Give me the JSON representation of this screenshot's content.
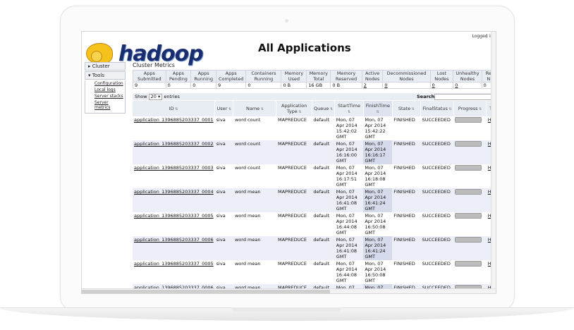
{
  "header": {
    "page_title": "All Applications",
    "logged_in": "Logged in"
  },
  "logo": {
    "text": "hadoop"
  },
  "nav": {
    "cluster_label": "▸ Cluster",
    "tools_label": "▾ Tools",
    "tools_links": [
      "Configuration",
      "Local logs",
      "Server stacks",
      "Server metrics"
    ]
  },
  "metrics": {
    "title": "Cluster Metrics",
    "headers": [
      "Apps Submitted",
      "Apps Pending",
      "Apps Running",
      "Apps Completed",
      "Containers Running",
      "Memory Used",
      "Memory Total",
      "Memory Reserved",
      "Active Nodes",
      "Decommissioned Nodes",
      "Lost Nodes",
      "Unhealthy Nodes",
      "Re N"
    ],
    "values": [
      "9",
      "0",
      "0",
      "9",
      "0",
      "0 B",
      "16 GB",
      "0 B",
      "2",
      "0",
      "0",
      "0",
      "0"
    ]
  },
  "controls": {
    "show_label": "Show",
    "entries_value": "20",
    "entries_label": "entries",
    "search_label": "Search:"
  },
  "table": {
    "headers": [
      "ID",
      "User",
      "Name",
      "Application Type",
      "Queue",
      "StartTime",
      "FinishTime",
      "State",
      "FinalStatus",
      "Progress",
      "T"
    ],
    "rows": [
      {
        "id": "application_1396885203337_0001",
        "user": "siva",
        "name": "word count",
        "type": "MAPREDUCE",
        "queue": "default",
        "start": "Mon, 07 Apr 2014 15:42:02 GMT",
        "finish": "Mon, 07 Apr 2014 15:42:22 GMT",
        "state": "FINISHED",
        "final": "SUCCEEDED",
        "progress": 1.0,
        "tracking": "H"
      },
      {
        "id": "application_1396885203337_0002",
        "user": "siva",
        "name": "word count",
        "type": "MAPREDUCE",
        "queue": "default",
        "start": "Mon, 07 Apr 2014 16:16:00 GMT",
        "finish": "Mon, 07 Apr 2014 16:16:17 GMT",
        "state": "FINISHED",
        "final": "SUCCEEDED",
        "progress": 1.0,
        "tracking": "H"
      },
      {
        "id": "application_1396885203337_0003",
        "user": "siva",
        "name": "word count",
        "type": "MAPREDUCE",
        "queue": "default",
        "start": "Mon, 07 Apr 2014 16:17:51 GMT",
        "finish": "Mon, 07 Apr 2014 16:18:08 GMT",
        "state": "FINISHED",
        "final": "SUCCEEDED",
        "progress": 1.0,
        "tracking": "H"
      },
      {
        "id": "application_1396885203337_0004",
        "user": "siva",
        "name": "word mean",
        "type": "MAPREDUCE",
        "queue": "default",
        "start": "Mon, 07 Apr 2014 16:41:08 GMT",
        "finish": "Mon, 07 Apr 2014 16:41:24 GMT",
        "state": "FINISHED",
        "final": "SUCCEEDED",
        "progress": 1.0,
        "tracking": "H"
      },
      {
        "id": "application_1396885203337_0005",
        "user": "siva",
        "name": "word mean",
        "type": "MAPREDUCE",
        "queue": "default",
        "start": "Mon, 07 Apr 2014 16:44:08 GMT",
        "finish": "Mon, 07 Apr 2014 16:50:08 GMT",
        "state": "FINISHED",
        "final": "SUCCEEDED",
        "progress": 1.0,
        "tracking": "H"
      },
      {
        "id": "application_1396885203337_0006",
        "user": "siva",
        "name": "word mean",
        "type": "MAPREDUCE",
        "queue": "default",
        "start": "Mon, 07 Apr 2014 16:41:08 GMT",
        "finish": "Mon, 07 Apr 2014 16:41:24 GMT",
        "state": "FINISHED",
        "final": "SUCCEEDED",
        "progress": 1.0,
        "tracking": "H"
      },
      {
        "id": "application_1396885203337_0005",
        "user": "siva",
        "name": "word mean",
        "type": "MAPREDUCE",
        "queue": "default",
        "start": "Mon, 07 Apr 2014 16:44:08 GMT",
        "finish": "Mon, 07 Apr 2014 16:50:08 GMT",
        "state": "FINISHED",
        "final": "SUCCEEDED",
        "progress": 1.0,
        "tracking": "H"
      },
      {
        "id": "application_1396885203337_0006",
        "user": "siva",
        "name": "word mean",
        "type": "MAPREDUCE",
        "queue": "default",
        "start": "Mon, 07",
        "finish": "Mon, 07",
        "state": "FINISHED",
        "final": "SUCCEEDED",
        "progress": 1.0,
        "tracking": "H"
      }
    ]
  },
  "icons": {
    "elephant": "hadoop-elephant-icon",
    "sort": "sort-arrows-icon"
  }
}
